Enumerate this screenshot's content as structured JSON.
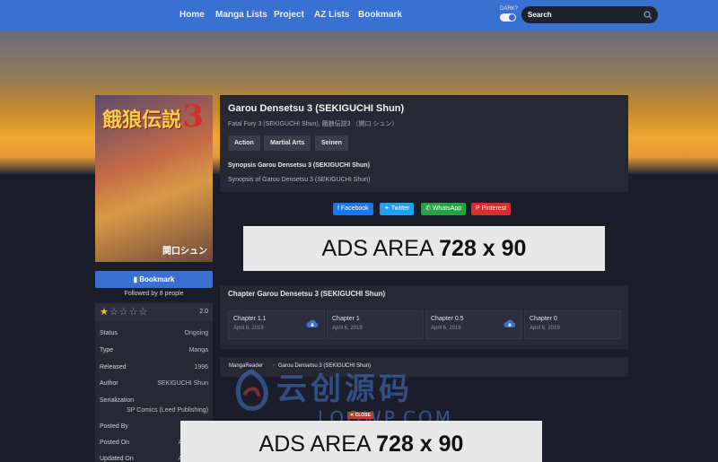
{
  "nav": {
    "links": [
      "Home",
      "Manga Lists",
      "Project",
      "AZ Lists",
      "Bookmark"
    ],
    "dark_label": "DARK?",
    "search_placeholder": "Search"
  },
  "cover": {
    "title_text": "餓狼伝説",
    "number": "3",
    "author_text": "関口シュン"
  },
  "sidebar": {
    "bookmark_label": "Bookmark",
    "followed": "Followed by 8 people",
    "rating_stars": 1,
    "rating_max": 5,
    "rating_value": "2.0",
    "info": [
      {
        "key": "Status",
        "value": "Ongoing"
      },
      {
        "key": "Type",
        "value": "Manga"
      },
      {
        "key": "Released",
        "value": "1996"
      },
      {
        "key": "Author",
        "value": "SEKIGUCHI Shun"
      },
      {
        "key": "Serialization",
        "value": "SP Comics (Leed Publishing)"
      },
      {
        "key": "Posted By",
        "value": ""
      },
      {
        "key": "Posted On",
        "value": "Ap"
      },
      {
        "key": "Updated On",
        "value": "Ap"
      }
    ]
  },
  "manga": {
    "title": "Garou Densetsu 3 (SEKIGUCHI Shun)",
    "alt_titles": "Fatal Fury 3 (SEKIGUCHI Shun), 餓狼伝説3 （関口 シュン）",
    "genres": [
      "Action",
      "Martial Arts",
      "Seinen"
    ],
    "synopsis_title": "Synopsis Garou Densetsu 3 (SEKIGUCHI Shun)",
    "synopsis_text": "Synopsis of Garou Densetsu 3 (SEKIGUCHI Shun)"
  },
  "share": {
    "facebook": "Facebook",
    "twitter": "Twitter",
    "whatsapp": "WhatsApp",
    "pinterest": "Pinterest",
    "colors": {
      "facebook": "#1877f2",
      "twitter": "#1da1f2",
      "whatsapp": "#25a244",
      "pinterest": "#d32f2f"
    }
  },
  "ads": {
    "text_light": "ADS AREA",
    "text_bold": "728 x 90",
    "close_label": "✕ CLOSE"
  },
  "chapters": {
    "heading": "Chapter Garou Densetsu 3 (SEKIGUCHI Shun)",
    "items": [
      {
        "name": "Chapter 1.1",
        "date": "April 6, 2019",
        "download": true
      },
      {
        "name": "Chapter 1",
        "date": "April 6, 2019",
        "download": false
      },
      {
        "name": "Chapter 0.5",
        "date": "April 6, 2019",
        "download": true
      },
      {
        "name": "Chapter 0",
        "date": "April 6, 2019",
        "download": false
      }
    ]
  },
  "breadcrumb": {
    "home": "MangaReader",
    "separator": "›",
    "current": "Garou Densetsu 3 (SEKIGUCHI Shun)"
  },
  "watermark": {
    "cn": "云创源码",
    "en": "LOOWP.COM"
  },
  "colors": {
    "accent": "#3a70cf",
    "panel": "#262836",
    "background": "#1b1d2a"
  }
}
